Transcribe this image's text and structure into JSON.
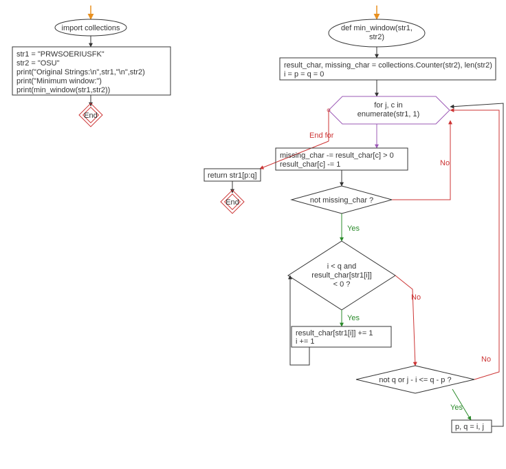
{
  "left": {
    "import": "import collections",
    "body_l1": "str1 = \"PRWSOERIUSFK\"",
    "body_l2": "str2 = \"OSU\"",
    "body_l3": "print(\"Original Strings:\\n\",str1,\"\\n\",str2)",
    "body_l4": "print(\"Minimum window:\")",
    "body_l5": "print(min_window(str1,str2))",
    "end": "End"
  },
  "right": {
    "fn_l1": "def min_window(str1,",
    "fn_l2": "str2)",
    "init_l1": "result_char, missing_char = collections.Counter(str2), len(str2)",
    "init_l2": "i = p = q = 0",
    "loop_l1": "for j, c in",
    "loop_l2": "enumerate(str1, 1)",
    "endfor": "End for",
    "return": "return str1[p:q]",
    "end": "End",
    "body_l1": "missing_char -= result_char[c] > 0",
    "body_l2": "result_char[c] -= 1",
    "cond1": "not missing_char ?",
    "cond2_l1": "i < q and",
    "cond2_l2": "result_char[str1[i]]",
    "cond2_l3": "< 0 ?",
    "inc_l1": "result_char[str1[i]] += 1",
    "inc_l2": "i += 1",
    "cond3": "not q or j - i <= q - p ?",
    "assign": "p, q = i, j"
  },
  "labels": {
    "yes": "Yes",
    "no": "No"
  }
}
